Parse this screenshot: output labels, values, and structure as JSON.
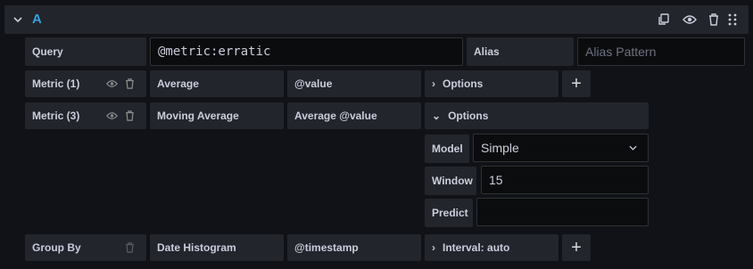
{
  "query_letter": "A",
  "query": {
    "label": "Query",
    "value": "@metric:erratic"
  },
  "alias": {
    "label": "Alias",
    "placeholder": "Alias Pattern"
  },
  "metric1": {
    "label": "Metric (1)",
    "aggregation": "Average",
    "field": "@value",
    "options_label": "Options"
  },
  "metric3": {
    "label": "Metric (3)",
    "aggregation": "Moving Average",
    "field": "Average @value",
    "options_label": "Options"
  },
  "options": {
    "model_label": "Model",
    "model_value": "Simple",
    "window_label": "Window",
    "window_value": "15",
    "predict_label": "Predict",
    "predict_value": ""
  },
  "group_by": {
    "label": "Group By",
    "type": "Date Histogram",
    "field": "@timestamp",
    "interval_label": "Interval: auto"
  },
  "add_symbol": "+",
  "colors": {
    "accent": "#33a2e5",
    "background": "#111217",
    "panel": "#22252b"
  }
}
